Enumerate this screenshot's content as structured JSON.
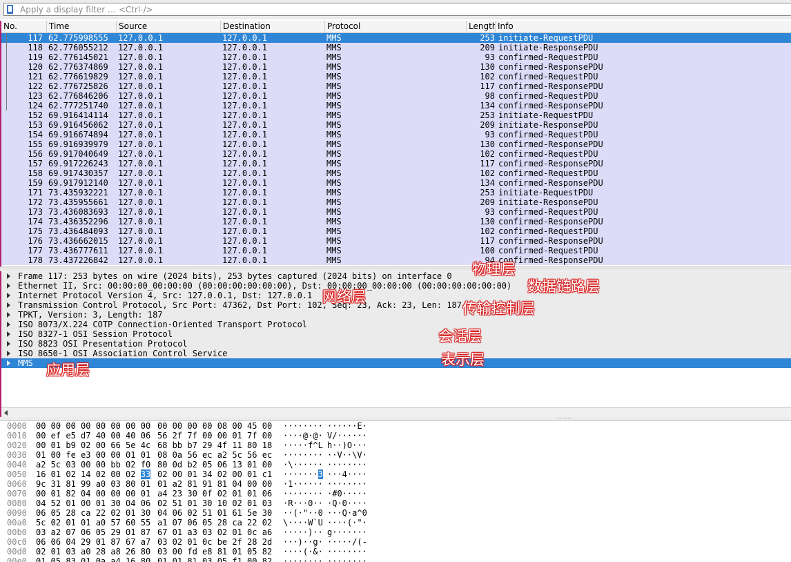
{
  "filter": {
    "placeholder": "Apply a display filter … <Ctrl-/>"
  },
  "columns": [
    "No.",
    "Time",
    "Source",
    "Destination",
    "Protocol",
    "Length",
    "Info"
  ],
  "packets": [
    {
      "no": "117",
      "time": "62.775998555",
      "src": "127.0.0.1",
      "dst": "127.0.0.1",
      "proto": "MMS",
      "len": "253",
      "info": "initiate-RequestPDU",
      "selected": true
    },
    {
      "no": "118",
      "time": "62.776055212",
      "src": "127.0.0.1",
      "dst": "127.0.0.1",
      "proto": "MMS",
      "len": "209",
      "info": "initiate-ResponsePDU"
    },
    {
      "no": "119",
      "time": "62.776145021",
      "src": "127.0.0.1",
      "dst": "127.0.0.1",
      "proto": "MMS",
      "len": "93",
      "info": "confirmed-RequestPDU"
    },
    {
      "no": "120",
      "time": "62.776374869",
      "src": "127.0.0.1",
      "dst": "127.0.0.1",
      "proto": "MMS",
      "len": "130",
      "info": "confirmed-ResponsePDU"
    },
    {
      "no": "121",
      "time": "62.776619829",
      "src": "127.0.0.1",
      "dst": "127.0.0.1",
      "proto": "MMS",
      "len": "102",
      "info": "confirmed-RequestPDU"
    },
    {
      "no": "122",
      "time": "62.776725826",
      "src": "127.0.0.1",
      "dst": "127.0.0.1",
      "proto": "MMS",
      "len": "117",
      "info": "confirmed-ResponsePDU"
    },
    {
      "no": "123",
      "time": "62.776846206",
      "src": "127.0.0.1",
      "dst": "127.0.0.1",
      "proto": "MMS",
      "len": "98",
      "info": "confirmed-RequestPDU"
    },
    {
      "no": "124",
      "time": "62.777251740",
      "src": "127.0.0.1",
      "dst": "127.0.0.1",
      "proto": "MMS",
      "len": "134",
      "info": "confirmed-ResponsePDU"
    },
    {
      "no": "152",
      "time": "69.916414114",
      "src": "127.0.0.1",
      "dst": "127.0.0.1",
      "proto": "MMS",
      "len": "253",
      "info": "initiate-RequestPDU"
    },
    {
      "no": "153",
      "time": "69.916456062",
      "src": "127.0.0.1",
      "dst": "127.0.0.1",
      "proto": "MMS",
      "len": "209",
      "info": "initiate-ResponsePDU"
    },
    {
      "no": "154",
      "time": "69.916674894",
      "src": "127.0.0.1",
      "dst": "127.0.0.1",
      "proto": "MMS",
      "len": "93",
      "info": "confirmed-RequestPDU"
    },
    {
      "no": "155",
      "time": "69.916939979",
      "src": "127.0.0.1",
      "dst": "127.0.0.1",
      "proto": "MMS",
      "len": "130",
      "info": "confirmed-ResponsePDU"
    },
    {
      "no": "156",
      "time": "69.917040649",
      "src": "127.0.0.1",
      "dst": "127.0.0.1",
      "proto": "MMS",
      "len": "102",
      "info": "confirmed-RequestPDU"
    },
    {
      "no": "157",
      "time": "69.917226243",
      "src": "127.0.0.1",
      "dst": "127.0.0.1",
      "proto": "MMS",
      "len": "117",
      "info": "confirmed-ResponsePDU"
    },
    {
      "no": "158",
      "time": "69.917430357",
      "src": "127.0.0.1",
      "dst": "127.0.0.1",
      "proto": "MMS",
      "len": "102",
      "info": "confirmed-RequestPDU"
    },
    {
      "no": "159",
      "time": "69.917912140",
      "src": "127.0.0.1",
      "dst": "127.0.0.1",
      "proto": "MMS",
      "len": "134",
      "info": "confirmed-ResponsePDU"
    },
    {
      "no": "171",
      "time": "73.435932221",
      "src": "127.0.0.1",
      "dst": "127.0.0.1",
      "proto": "MMS",
      "len": "253",
      "info": "initiate-RequestPDU"
    },
    {
      "no": "172",
      "time": "73.435955661",
      "src": "127.0.0.1",
      "dst": "127.0.0.1",
      "proto": "MMS",
      "len": "209",
      "info": "initiate-ResponsePDU"
    },
    {
      "no": "173",
      "time": "73.436083693",
      "src": "127.0.0.1",
      "dst": "127.0.0.1",
      "proto": "MMS",
      "len": "93",
      "info": "confirmed-RequestPDU"
    },
    {
      "no": "174",
      "time": "73.436352296",
      "src": "127.0.0.1",
      "dst": "127.0.0.1",
      "proto": "MMS",
      "len": "130",
      "info": "confirmed-ResponsePDU"
    },
    {
      "no": "175",
      "time": "73.436484093",
      "src": "127.0.0.1",
      "dst": "127.0.0.1",
      "proto": "MMS",
      "len": "102",
      "info": "confirmed-RequestPDU"
    },
    {
      "no": "176",
      "time": "73.436662015",
      "src": "127.0.0.1",
      "dst": "127.0.0.1",
      "proto": "MMS",
      "len": "117",
      "info": "confirmed-ResponsePDU"
    },
    {
      "no": "177",
      "time": "73.436777611",
      "src": "127.0.0.1",
      "dst": "127.0.0.1",
      "proto": "MMS",
      "len": "100",
      "info": "confirmed-RequestPDU"
    },
    {
      "no": "178",
      "time": "73.437226842",
      "src": "127.0.0.1",
      "dst": "127.0.0.1",
      "proto": "MMS",
      "len": "94",
      "info": "confirmed-ResponsePDU"
    }
  ],
  "details": [
    {
      "text": "Frame 117: 253 bytes on wire (2024 bits), 253 bytes captured (2024 bits) on interface 0"
    },
    {
      "text": "Ethernet II, Src: 00:00:00_00:00:00 (00:00:00:00:00:00), Dst: 00:00:00_00:00:00 (00:00:00:00:00:00)"
    },
    {
      "text": "Internet Protocol Version 4, Src: 127.0.0.1, Dst: 127.0.0.1"
    },
    {
      "text": "Transmission Control Protocol, Src Port: 47362, Dst Port: 102, Seq: 23, Ack: 23, Len: 187"
    },
    {
      "text": "TPKT, Version: 3, Length: 187"
    },
    {
      "text": "ISO 8073/X.224 COTP Connection-Oriented Transport Protocol"
    },
    {
      "text": "ISO 8327-1 OSI Session Protocol"
    },
    {
      "text": "ISO 8823 OSI Presentation Protocol"
    },
    {
      "text": "ISO 8650-1 OSI Association Control Service"
    },
    {
      "text": "MMS",
      "selected": true
    }
  ],
  "annotations": [
    "物理层",
    "数据链路层",
    "网络层",
    "传输控制层",
    "会话层",
    "表示层",
    "应用层"
  ],
  "bytes": [
    {
      "off": "0000",
      "h1": "00 00 00 00 00 00 00 00",
      "h2": "00 00 00 00 08 00 45 00",
      "a1": "········",
      "a2": "······E·"
    },
    {
      "off": "0010",
      "h1": "00 ef e5 d7 40 00 40 06",
      "h2": "56 2f 7f 00 00 01 7f 00",
      "a1": "····@·@·",
      "a2": "V/······"
    },
    {
      "off": "0020",
      "h1": "00 01 b9 02 00 66 5e 4c",
      "h2": "68 bb b7 29 4f 11 80 18",
      "a1": "·····f^L",
      "a2": "h··)O···"
    },
    {
      "off": "0030",
      "h1": "01 00 fe e3 00 00 01 01",
      "h2": "08 0a 56 ec a2 5c 56 ec",
      "a1": "········",
      "a2": "··V··\\V·"
    },
    {
      "off": "0040",
      "h1": "a2 5c 03 00 00 bb 02 f0",
      "h2": "80 0d b2 05 06 13 01 00",
      "a1": "·\\······",
      "a2": "········"
    },
    {
      "off": "0050",
      "h1a": "16 01 02 14 02 00 02 ",
      "hlh": "33",
      "h2": "02 00 01 34 02 00 01 c1",
      "a1a": "·······",
      "hla": "3",
      "a2": "···4····"
    },
    {
      "off": "0060",
      "h1": "9c 31 81 99 a0 03 80 01",
      "h2": "01 a2 81 91 81 04 00 00",
      "a1": "·1······",
      "a2": "········"
    },
    {
      "off": "0070",
      "h1": "00 01 82 04 00 00 00 01",
      "h2": "a4 23 30 0f 02 01 01 06",
      "a1": "········",
      "a2": "·#0·····"
    },
    {
      "off": "0080",
      "h1": "04 52 01 00 01 30 04 06",
      "h2": "02 51 01 30 10 02 01 03",
      "a1": "·R···0··",
      "a2": "·Q·0····"
    },
    {
      "off": "0090",
      "h1": "06 05 28 ca 22 02 01 30",
      "h2": "04 06 02 51 01 61 5e 30",
      "a1": "··(·\"··0",
      "a2": "···Q·a^0"
    },
    {
      "off": "00a0",
      "h1": "5c 02 01 01 a0 57 60 55",
      "h2": "a1 07 06 05 28 ca 22 02",
      "a1": "\\····W`U",
      "a2": "····(·\"·"
    },
    {
      "off": "00b0",
      "h1": "03 a2 07 06 05 29 01 87",
      "h2": "67 01 a3 03 02 01 0c a6",
      "a1": "·····)··",
      "a2": "g·······"
    },
    {
      "off": "00c0",
      "h1": "06 06 04 29 01 87 67 a7",
      "h2": "03 02 01 0c be 2f 28 2d",
      "a1": "···)··g·",
      "a2": "·····/(-"
    },
    {
      "off": "00d0",
      "h1": "02 01 03 a0 28 a8 26 80",
      "h2": "03 00 fd e8 81 01 05 82",
      "a1": "····(·&·",
      "a2": "········"
    },
    {
      "off": "00e0",
      "h1": "01 05 83 01 0a a4 16 80",
      "h2": "01 01 81 03 05 f1 00 82",
      "a1": "········",
      "a2": "········"
    }
  ]
}
